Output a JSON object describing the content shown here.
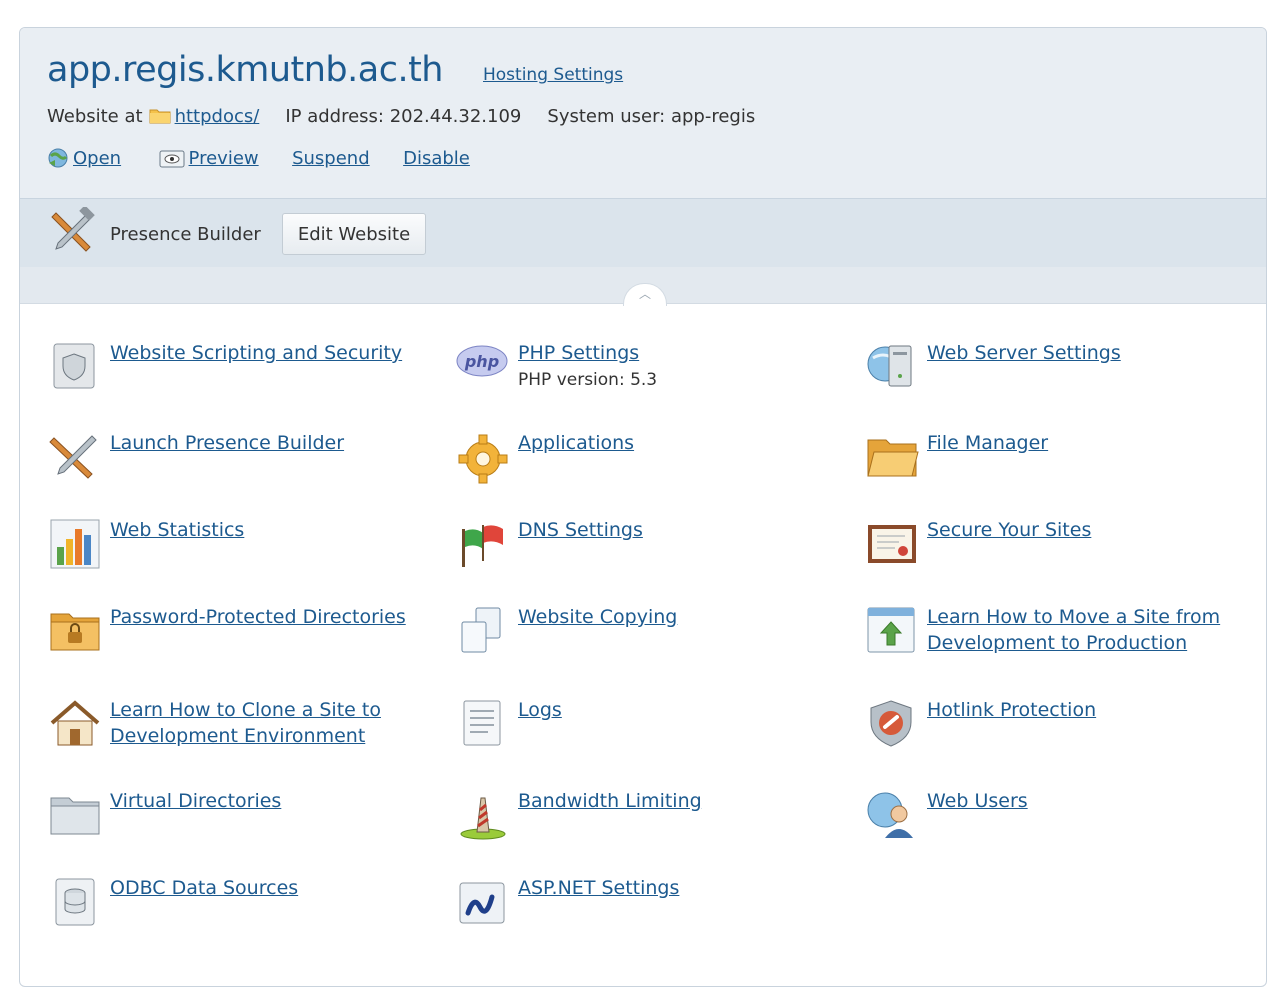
{
  "header": {
    "site_title": "app.regis.kmutnb.ac.th",
    "hosting_settings": "Hosting Settings",
    "website_at": "Website at",
    "docroot": "httpdocs/",
    "ip_address": "IP address: 202.44.32.109",
    "system_user": "System user: app-regis",
    "actions": {
      "open": "Open",
      "preview": "Preview",
      "suspend": "Suspend",
      "disable": "Disable"
    }
  },
  "builder": {
    "label": "Presence Builder",
    "edit_button": "Edit Website"
  },
  "tools": {
    "col1": [
      {
        "label": "Website Scripting and Security",
        "icon": "shield-doc-icon"
      },
      {
        "label": "Launch Presence Builder",
        "icon": "tools-icon"
      },
      {
        "label": "Web Statistics",
        "icon": "bar-chart-icon"
      },
      {
        "label": "Password-Protected Directories",
        "icon": "locked-folder-icon"
      },
      {
        "label1": "Learn How to Clone a Site to",
        "label2": "Development Environment",
        "icon": "house-icon"
      },
      {
        "label": "Virtual Directories",
        "icon": "folder-icon"
      },
      {
        "label": "ODBC Data Sources",
        "icon": "database-icon"
      }
    ],
    "col2": [
      {
        "label": "PHP Settings",
        "sub": "PHP version: 5.3",
        "icon": "php-icon"
      },
      {
        "label": "Applications",
        "icon": "gear-icon"
      },
      {
        "label": "DNS Settings",
        "icon": "flags-icon"
      },
      {
        "label": "Website Copying",
        "icon": "copy-icon"
      },
      {
        "label": "Logs",
        "icon": "log-document-icon"
      },
      {
        "label": "Bandwidth Limiting",
        "icon": "traffic-cone-icon"
      },
      {
        "label": "ASP.NET Settings",
        "icon": "aspnet-icon"
      }
    ],
    "col3": [
      {
        "label": "Web Server Settings",
        "icon": "server-globe-icon"
      },
      {
        "label": "File Manager",
        "icon": "open-folder-icon"
      },
      {
        "label": "Secure Your Sites",
        "icon": "certificate-icon"
      },
      {
        "label1": "Learn How to Move a Site from",
        "label2": "Development to Production",
        "icon": "upload-window-icon"
      },
      {
        "label": "Hotlink Protection",
        "icon": "chain-shield-icon"
      },
      {
        "label": "Web Users",
        "icon": "globe-user-icon"
      }
    ]
  }
}
